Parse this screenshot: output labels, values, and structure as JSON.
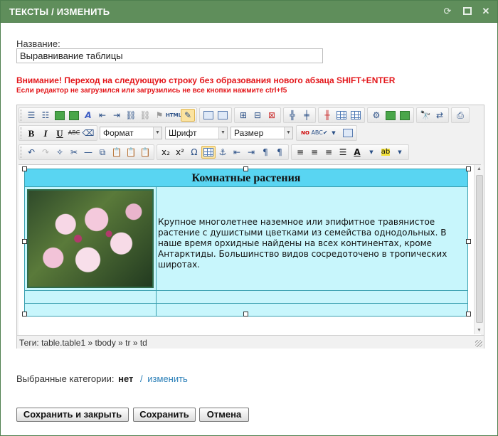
{
  "window": {
    "title": "ТЕКСТЫ / ИЗМЕНИТЬ",
    "controls": {
      "refresh": "⟳",
      "close": "✕"
    }
  },
  "form": {
    "name_label": "Название:",
    "name_value": "Выравнивание таблицы",
    "warning_primary": "Внимание! Переход на следующую строку без образования нового абзаца SHIFT+ENTER",
    "warning_secondary": "Если редактор не загрузился или загрузились не все кнопки нажмите ctrl+f5"
  },
  "toolbar": {
    "format_select": "Формат",
    "font_select": "Шрифт",
    "size_select": "Размер",
    "bold": "B",
    "italic": "I",
    "underline": "U",
    "strike": "ABC",
    "html": "HTML",
    "icons": [
      "bullet-list",
      "numbered-list",
      "insert-image",
      "insert-media",
      "font-color",
      "outdent",
      "indent",
      "link",
      "unlink",
      "anchor",
      "html-source",
      "edit",
      "table-tools",
      "find",
      "replace",
      "print",
      "spellcheck",
      "undo",
      "redo",
      "cut",
      "copy",
      "paste",
      "subscript",
      "superscript",
      "special-char",
      "table",
      "align-left",
      "align-center",
      "align-right",
      "justify",
      "text-color",
      "highlight-color"
    ]
  },
  "editor_content": {
    "table_title": "Комнатные растения",
    "description": "Крупное многолетнее наземное или эпифитное травянистое растение с душистыми цветками из семейства однодольных. В наше время орхидные найдены на всех континентах, кроме Антарктиды. Большинство видов сосредоточено в тропических широтах.",
    "image": "orchid-photo"
  },
  "statusbar": {
    "path": "Теги: table.table1 » tbody » tr » td"
  },
  "categories": {
    "label": "Выбранные категории:",
    "value": "нет",
    "separator": "/",
    "change_link": "изменить"
  },
  "buttons": {
    "save_close": "Сохранить и закрыть",
    "save": "Сохранить",
    "cancel": "Отмена"
  },
  "colors": {
    "titlebar": "#5f8e5b",
    "warning": "#e3161a",
    "table_header": "#59d5f2",
    "table_body": "#c8f6fc",
    "link": "#2a7fb8"
  }
}
